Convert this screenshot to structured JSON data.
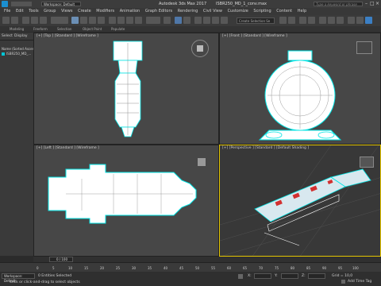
{
  "title_bar": {
    "workspace_label": "Workspace: Default",
    "app_title": "Autodesk 3ds Max 2017",
    "file_name": "ISBR250_MD_1_conv.max",
    "search_placeholder": "Type a keyword or phrase"
  },
  "menu": {
    "items": [
      "File",
      "Edit",
      "Tools",
      "Group",
      "Views",
      "Create",
      "Modifiers",
      "Animation",
      "Graph Editors",
      "Rendering",
      "Civil View",
      "Customize",
      "Scripting",
      "Content",
      "Help"
    ]
  },
  "toolbar": {
    "selection_set_placeholder": "Create Selection Se"
  },
  "ribbon": {
    "tabs": [
      "Modeling",
      "Freeform",
      "Selection",
      "Object Paint",
      "Populate"
    ]
  },
  "left_panel": {
    "tabs": [
      "Select",
      "Display"
    ],
    "scene_root": "Name (Sorted Ascending)",
    "object_name": "ISBR250_MD_..."
  },
  "viewports": {
    "top_label": "[+] [Top ] [Standard ] [Wireframe ]",
    "front_label": "[+] [Front ] [Standard ] [Wireframe ]",
    "left_label": "[+] [Left ] [Standard ] [Wireframe ]",
    "perspective_label": "[+] [Perspective ] [Standard ] [Default Shading ]"
  },
  "timeline": {
    "frame_counter": "0 / 100",
    "ticks": [
      "0",
      "5",
      "10",
      "15",
      "20",
      "25",
      "30",
      "35",
      "40",
      "45",
      "50",
      "55",
      "60",
      "65",
      "70",
      "75",
      "80",
      "85",
      "90",
      "95",
      "100"
    ]
  },
  "status": {
    "workspace_short": "Workspace: Default",
    "selection_info": "0 Entities Selected",
    "prompt": "Click or click-and-drag to select objects",
    "x_label": "X:",
    "y_label": "Y:",
    "z_label": "Z:",
    "grid_label": "Grid = 10,0",
    "add_time_tag": "Add Time Tag"
  },
  "colors": {
    "wire_cyan": "#00e5e5",
    "wire_white": "#ffffff",
    "viewport_bg": "#474747",
    "perspective_bg": "#383838",
    "model_red": "#d23030"
  }
}
